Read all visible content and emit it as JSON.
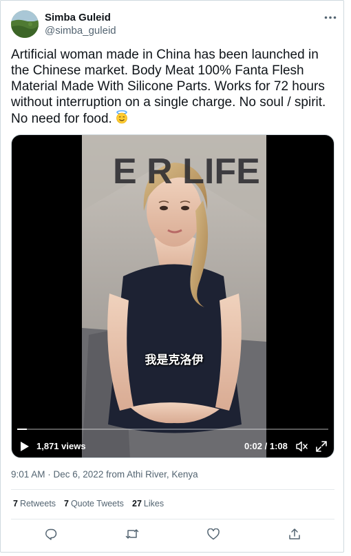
{
  "author": {
    "name": "Simba Guleid",
    "handle": "@simba_guleid"
  },
  "tweet": {
    "text": "Artificial woman made in China has been launched in the Chinese market. Body Meat 100% Fanta Flesh Material Made With Silicone Parts. Works for 72 hours without interruption on a single charge. No soul / spirit. No need for food.",
    "emoji": "smiling-face-with-halo"
  },
  "video": {
    "subtitle": "我是克洛伊",
    "overlay_text": "E R LIFE",
    "views": "1,871 views",
    "time": "0:02 / 1:08",
    "progress": 0.03
  },
  "meta": {
    "timestamp": "9:01 AM · Dec 6, 2022 from Athi River, Kenya"
  },
  "stats": {
    "retweets_count": "7",
    "retweets_label": "Retweets",
    "quote_count": "7",
    "quote_label": "Quote Tweets",
    "likes_count": "27",
    "likes_label": "Likes"
  },
  "actions": [
    "reply-icon",
    "retweet-icon",
    "like-icon",
    "share-icon"
  ],
  "colors": {
    "text": "#0f1419",
    "secondary": "#536471",
    "border": "#cfd9de"
  }
}
